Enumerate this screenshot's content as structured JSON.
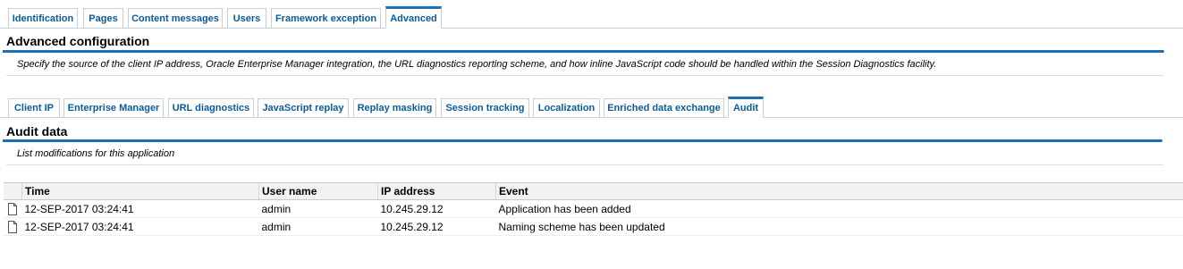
{
  "top_tabs": [
    "Identification",
    "Pages",
    "Content messages",
    "Users",
    "Framework exception",
    "Advanced"
  ],
  "top_active": "Advanced",
  "advanced": {
    "title": "Advanced configuration",
    "description": "Specify the source of the client IP address, Oracle Enterprise Manager integration, the URL diagnostics reporting scheme, and how inline JavaScript code should be handled within the Session Diagnostics facility."
  },
  "sub_tabs": [
    "Client IP",
    "Enterprise Manager",
    "URL diagnostics",
    "JavaScript replay",
    "Replay masking",
    "Session tracking",
    "Localization",
    "Enriched data exchange",
    "Audit"
  ],
  "sub_active": "Audit",
  "audit": {
    "title": "Audit data",
    "description": "List modifications for this application",
    "columns": [
      "Time",
      "User name",
      "IP address",
      "Event"
    ],
    "rows": [
      {
        "time": "12-SEP-2017 03:24:41",
        "user": "admin",
        "ip": "10.245.29.12",
        "event": "Application has been added",
        "icon": "document-icon"
      },
      {
        "time": "12-SEP-2017 03:24:41",
        "user": "admin",
        "ip": "10.245.29.12",
        "event": "Naming scheme has been updated",
        "icon": "document-icon"
      }
    ]
  }
}
